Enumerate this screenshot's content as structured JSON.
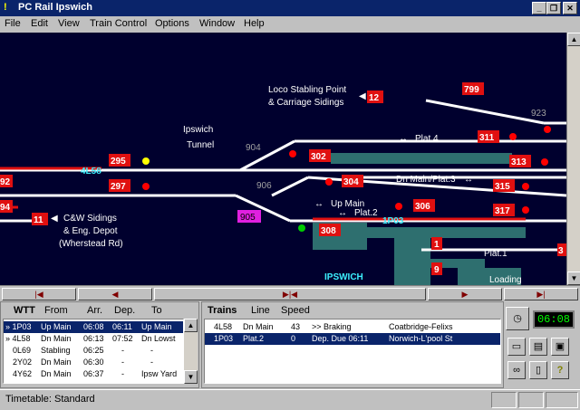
{
  "window": {
    "title": "PC Rail Ipswich"
  },
  "menu": [
    "File",
    "Edit",
    "View",
    "Train Control",
    "Options",
    "Window",
    "Help"
  ],
  "colors": {
    "track": "#ffffff",
    "occupied": "#e01010",
    "platform": "#2e6f6f",
    "signal_red": "#ff0000",
    "signal_green": "#00cc00",
    "signal_yellow": "#ffff00",
    "bg": "#00002e",
    "train_id": "#3cf0ff"
  },
  "layout": {
    "loco_stabling": "Loco Stabling Point",
    "carriage_sidings": "& Carriage Sidings",
    "ipswich_tunnel_1": "Ipswich",
    "ipswich_tunnel_2": "Tunnel",
    "plat4": "Plat.4",
    "dn_main_plat3": "Dn Main/Plat.3",
    "up_main": "Up Main",
    "plat2": "Plat.2",
    "plat1": "Plat.1",
    "cw_sidings": "C&W Sidings",
    "eng_depot": "& Eng. Depot",
    "wherstead": "(Wherstead Rd)",
    "station": "IPSWICH",
    "loading": "Loading",
    "arrow_lr": "↔",
    "arrow_left": "◀",
    "arrow_right": "▶"
  },
  "signals": [
    "799",
    "12",
    "311",
    "302",
    "313",
    "295",
    "297",
    "304",
    "315",
    "306",
    "317",
    "11",
    "308",
    "1",
    "9",
    "92",
    "94",
    "3"
  ],
  "track_numbers": [
    "923",
    "904",
    "906"
  ],
  "berths": {
    "b1": "4L58",
    "b2": "1P03",
    "b3": "905"
  },
  "wtt": {
    "title": "WTT",
    "headers": [
      "From",
      "Arr.",
      "Dep.",
      "To"
    ],
    "rows": [
      {
        "id": "» 1P03",
        "from": "Up Main",
        "arr": "06:08",
        "dep": "06:11",
        "to": "Up Main"
      },
      {
        "id": "» 4L58",
        "from": "Dn Main",
        "arr": "06:13",
        "dep": "07:52",
        "to": "Dn Lowst"
      },
      {
        "id": "0L69",
        "from": "Stabling",
        "arr": "06:25",
        "dep": "-",
        "to": "-"
      },
      {
        "id": "2Y02",
        "from": "Dn Main",
        "arr": "06:30",
        "dep": "-",
        "to": "-"
      },
      {
        "id": "4Y62",
        "from": "Dn Main",
        "arr": "06:37",
        "dep": "-",
        "to": "Ipsw Yard"
      }
    ]
  },
  "trains": {
    "title": "Trains",
    "headers": [
      "Line",
      "Speed"
    ],
    "rows": [
      {
        "id": "4L58",
        "line": "Dn Main",
        "speed": "43",
        "status": ">> Braking",
        "dest": "Coatbridge-Felixs"
      },
      {
        "id": "1P03",
        "line": "Plat.2",
        "speed": "0",
        "status": "Dep. Due 06:11",
        "dest": "Norwich-L'pool St"
      }
    ]
  },
  "clock": "06:08",
  "status": {
    "timetable": "Timetable: Standard"
  }
}
